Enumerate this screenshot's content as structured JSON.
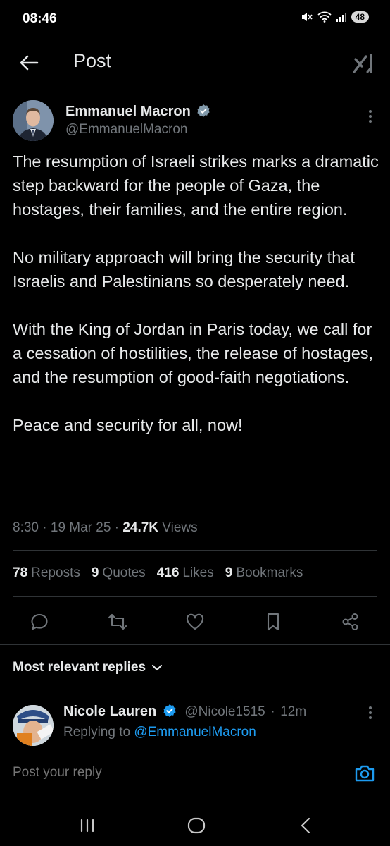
{
  "status_bar": {
    "time": "08:46",
    "battery": "48"
  },
  "header": {
    "title": "Post"
  },
  "post": {
    "author_name": "Emmanuel Macron",
    "author_handle": "@EmmanuelMacron",
    "paragraphs": [
      "The resumption of Israeli strikes marks a dramatic step backward for the people of Gaza, the hostages, their families, and the entire region.",
      "No military approach will bring the security that Israelis and Palestinians so desperately need.",
      "With the King of Jordan in Paris today, we call for a cessation of hostilities, the release of hostages, and the resumption of good-faith negotiations.",
      "Peace and security for all, now!"
    ],
    "time": "8:30",
    "date": "19 Mar 25",
    "views_count": "24.7K",
    "views_label": "Views"
  },
  "stats": [
    {
      "count": "78",
      "label": "Reposts"
    },
    {
      "count": "9",
      "label": "Quotes"
    },
    {
      "count": "416",
      "label": "Likes"
    },
    {
      "count": "9",
      "label": "Bookmarks"
    }
  ],
  "replies": {
    "header": "Most relevant replies",
    "items": [
      {
        "name": "Nicole Lauren",
        "handle": "@Nicole1515",
        "age": "12m",
        "replying_to_prefix": "Replying to",
        "replying_to_handle": "@EmmanuelMacron"
      }
    ]
  },
  "compose": {
    "placeholder": "Post your reply"
  },
  "colors": {
    "accent": "#1d9bf0",
    "muted": "#71767b",
    "text": "#e7e9ea",
    "divider": "#2f3336"
  }
}
